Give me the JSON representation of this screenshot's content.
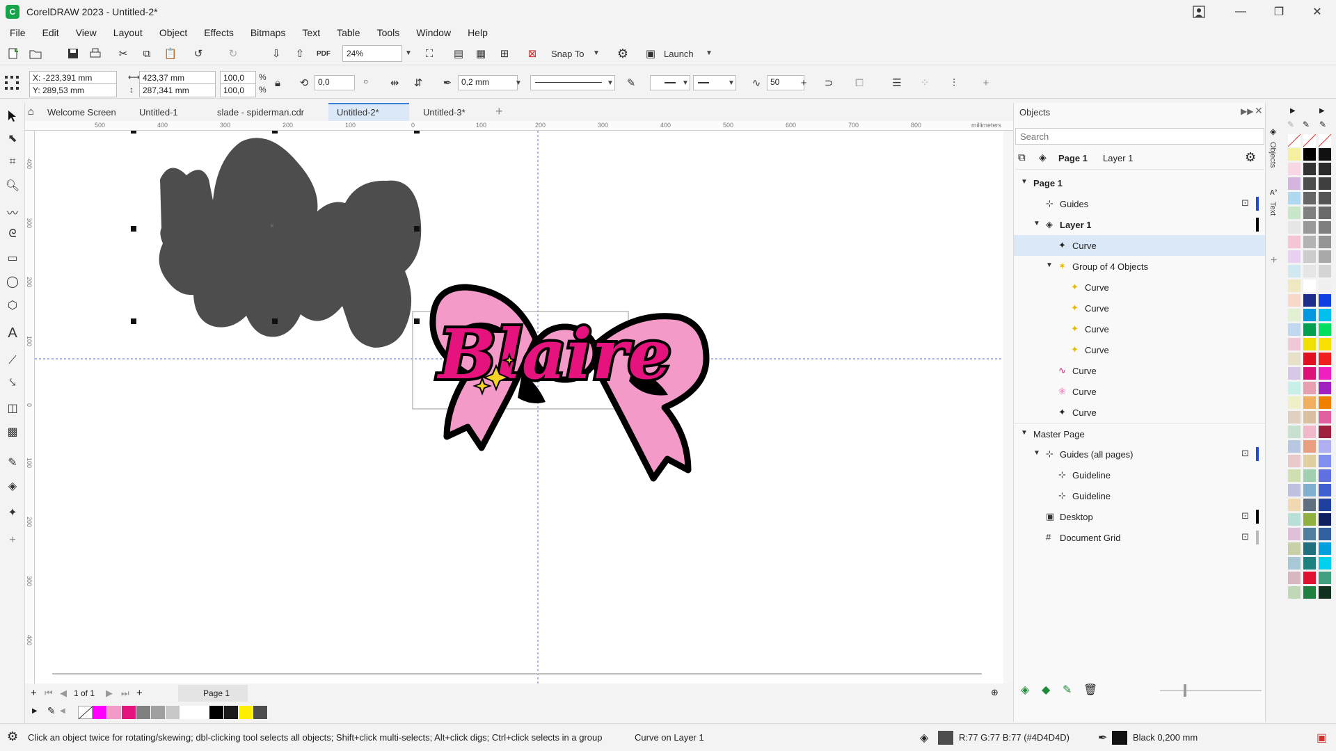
{
  "window": {
    "title": "CorelDRAW 2023 - Untitled-2*",
    "app_icon_letter": "C",
    "minimize_glyph": "—",
    "maximize_glyph": "❐",
    "close_glyph": "✕"
  },
  "menu": [
    "File",
    "Edit",
    "View",
    "Layout",
    "Object",
    "Effects",
    "Bitmaps",
    "Text",
    "Table",
    "Tools",
    "Window",
    "Help"
  ],
  "toolbar": {
    "zoom": "24%",
    "snap_to": "Snap To",
    "launch": "Launch",
    "pdf_label": "PDF"
  },
  "property_bar": {
    "x": "X: -223,391 mm",
    "y": "Y: 289,53 mm",
    "width": "423,37 mm",
    "height": "287,341 mm",
    "scale_x": "100,0",
    "scale_y": "100,0",
    "percent": "%",
    "rotation": "0,0",
    "outline_width": "0,2 mm",
    "smoothing": "50"
  },
  "doc_tabs": [
    {
      "label": "Welcome Screen",
      "active": false
    },
    {
      "label": "Untitled-1",
      "active": false
    },
    {
      "label": "slade - spiderman.cdr",
      "active": false
    },
    {
      "label": "Untitled-2*",
      "active": true
    },
    {
      "label": "Untitled-3*",
      "active": false
    }
  ],
  "ruler": {
    "unit": "millimeters",
    "top_ticks": [
      "500",
      "400",
      "300",
      "200",
      "100",
      "0",
      "100",
      "200",
      "300",
      "400",
      "500",
      "600",
      "700",
      "800"
    ],
    "left_ticks": [
      "400",
      "300",
      "200",
      "100",
      "0",
      "100",
      "200",
      "300",
      "400"
    ]
  },
  "canvas": {
    "text_art": "Blaire",
    "colors": {
      "silhouette": "#4D4D4D",
      "bow_pink": "#F49AC9",
      "text_pink": "#E6127E",
      "sparkle": "#F5D327",
      "outline": "#000000",
      "guide": "#5a6bd0"
    }
  },
  "page_nav": {
    "counter": "1 of 1",
    "page_tab": "Page 1"
  },
  "status": {
    "hint": "Click an object twice for rotating/skewing; dbl-clicking tool selects all objects; Shift+click multi-selects; Alt+click digs; Ctrl+click selects in a group",
    "selection": "Curve on Layer 1",
    "fill": "R:77 G:77 B:77 (#4D4D4D)",
    "outline": "Black  0,200 mm"
  },
  "objects_panel": {
    "title": "Objects",
    "search_placeholder": "Search",
    "header_page": "Page 1",
    "header_layer": "Layer 1",
    "tree": [
      {
        "label": "Page 1",
        "indent": 0,
        "kind": "page",
        "bold": true,
        "expanded": true
      },
      {
        "label": "Guides",
        "indent": 1,
        "kind": "guides",
        "bar": "#1e4bd8",
        "lock": true
      },
      {
        "label": "Layer 1",
        "indent": 1,
        "kind": "layer",
        "bold": true,
        "expanded": true,
        "bar": "#000000"
      },
      {
        "label": "Curve",
        "indent": 2,
        "kind": "curve-dark",
        "selected": true
      },
      {
        "label": "Group of 4 Objects",
        "indent": 2,
        "kind": "group",
        "expanded": true
      },
      {
        "label": "Curve",
        "indent": 3,
        "kind": "sparkle"
      },
      {
        "label": "Curve",
        "indent": 3,
        "kind": "sparkle"
      },
      {
        "label": "Curve",
        "indent": 3,
        "kind": "sparkle"
      },
      {
        "label": "Curve",
        "indent": 3,
        "kind": "sparkle"
      },
      {
        "label": "Curve",
        "indent": 2,
        "kind": "curve-text"
      },
      {
        "label": "Curve",
        "indent": 2,
        "kind": "curve-pink"
      },
      {
        "label": "Curve",
        "indent": 2,
        "kind": "curve-dark"
      },
      {
        "label": "Master Page",
        "indent": 0,
        "kind": "page",
        "expanded": true,
        "sep": true
      },
      {
        "label": "Guides (all pages)",
        "indent": 1,
        "kind": "guides",
        "expanded": true,
        "bar": "#1e4bd8",
        "lock": true
      },
      {
        "label": "Guideline",
        "indent": 2,
        "kind": "guideline"
      },
      {
        "label": "Guideline",
        "indent": 2,
        "kind": "guideline"
      },
      {
        "label": "Desktop",
        "indent": 1,
        "kind": "desktop",
        "bar": "#000000",
        "lock": true
      },
      {
        "label": "Document Grid",
        "indent": 1,
        "kind": "grid",
        "bar": "#bbbbbb",
        "lock": true
      }
    ]
  },
  "docker_tabs": [
    "Objects",
    "Text"
  ],
  "doc_palette": [
    "none",
    "#ff00ff",
    "#f49ac9",
    "#e6127e",
    "#808080",
    "#a0a0a0",
    "#c8c8c8",
    "#ffffff",
    "#ffffff",
    "#000000",
    "#1a1a1a",
    "#ffee00",
    "#4d4d4d"
  ],
  "color_palette": {
    "col1": [
      "#f5f0a0",
      "#f7d7e6",
      "#d6b4e0",
      "#b0d8f0",
      "#c8e6c8",
      "#e6e6e6",
      "#f5c6d6",
      "#e8d0f0",
      "#d0e8f0",
      "#f0e8c0",
      "#f8d8c8",
      "#e0f0d0",
      "#c0d8f0",
      "#f0c8d8",
      "#e8e0c8",
      "#d8c8e8",
      "#c8f0e8",
      "#f0f0c8",
      "#e0d0c0",
      "#c8e0d0",
      "#b8c8e0",
      "#e8c8c8",
      "#d0e0b0",
      "#c0c0e0",
      "#f0d8b0",
      "#b8e0d8",
      "#e0c0d8",
      "#c8d0a8",
      "#a8c8d8",
      "#d8b8c0",
      "#c0d8b8"
    ],
    "col2": [
      "#000000",
      "#333333",
      "#4d4d4d",
      "#666666",
      "#808080",
      "#999999",
      "#b3b3b3",
      "#cccccc",
      "#e6e6e6",
      "#ffffff",
      "#1f2d8a",
      "#0099e0",
      "#00a050",
      "#f0e000",
      "#e01020",
      "#e0107a",
      "#e6a0b0",
      "#f0b060",
      "#d8c0a0",
      "#f0b8c8",
      "#e8a080",
      "#e0d0a0",
      "#a0d0b0",
      "#80b0d0",
      "#607080",
      "#90b040",
      "#5080a0",
      "#207080",
      "#208080",
      "#e01030",
      "#208040"
    ],
    "col3": [
      "#111111",
      "#2a2a2a",
      "#404040",
      "#555555",
      "#6a6a6a",
      "#7f7f7f",
      "#949494",
      "#a9a9a9",
      "#d4d4d4",
      "#f0f0f0",
      "#1040e0",
      "#00c0f0",
      "#00e060",
      "#f8e000",
      "#f02020",
      "#f020c0",
      "#a020c0",
      "#f08000",
      "#e060a0",
      "#a02040",
      "#b0b0f0",
      "#8090f0",
      "#6070e0",
      "#4060d0",
      "#2040a0",
      "#102060",
      "#3060a0",
      "#00a0e0",
      "#00d0f0",
      "#40a080",
      "#103020"
    ]
  }
}
